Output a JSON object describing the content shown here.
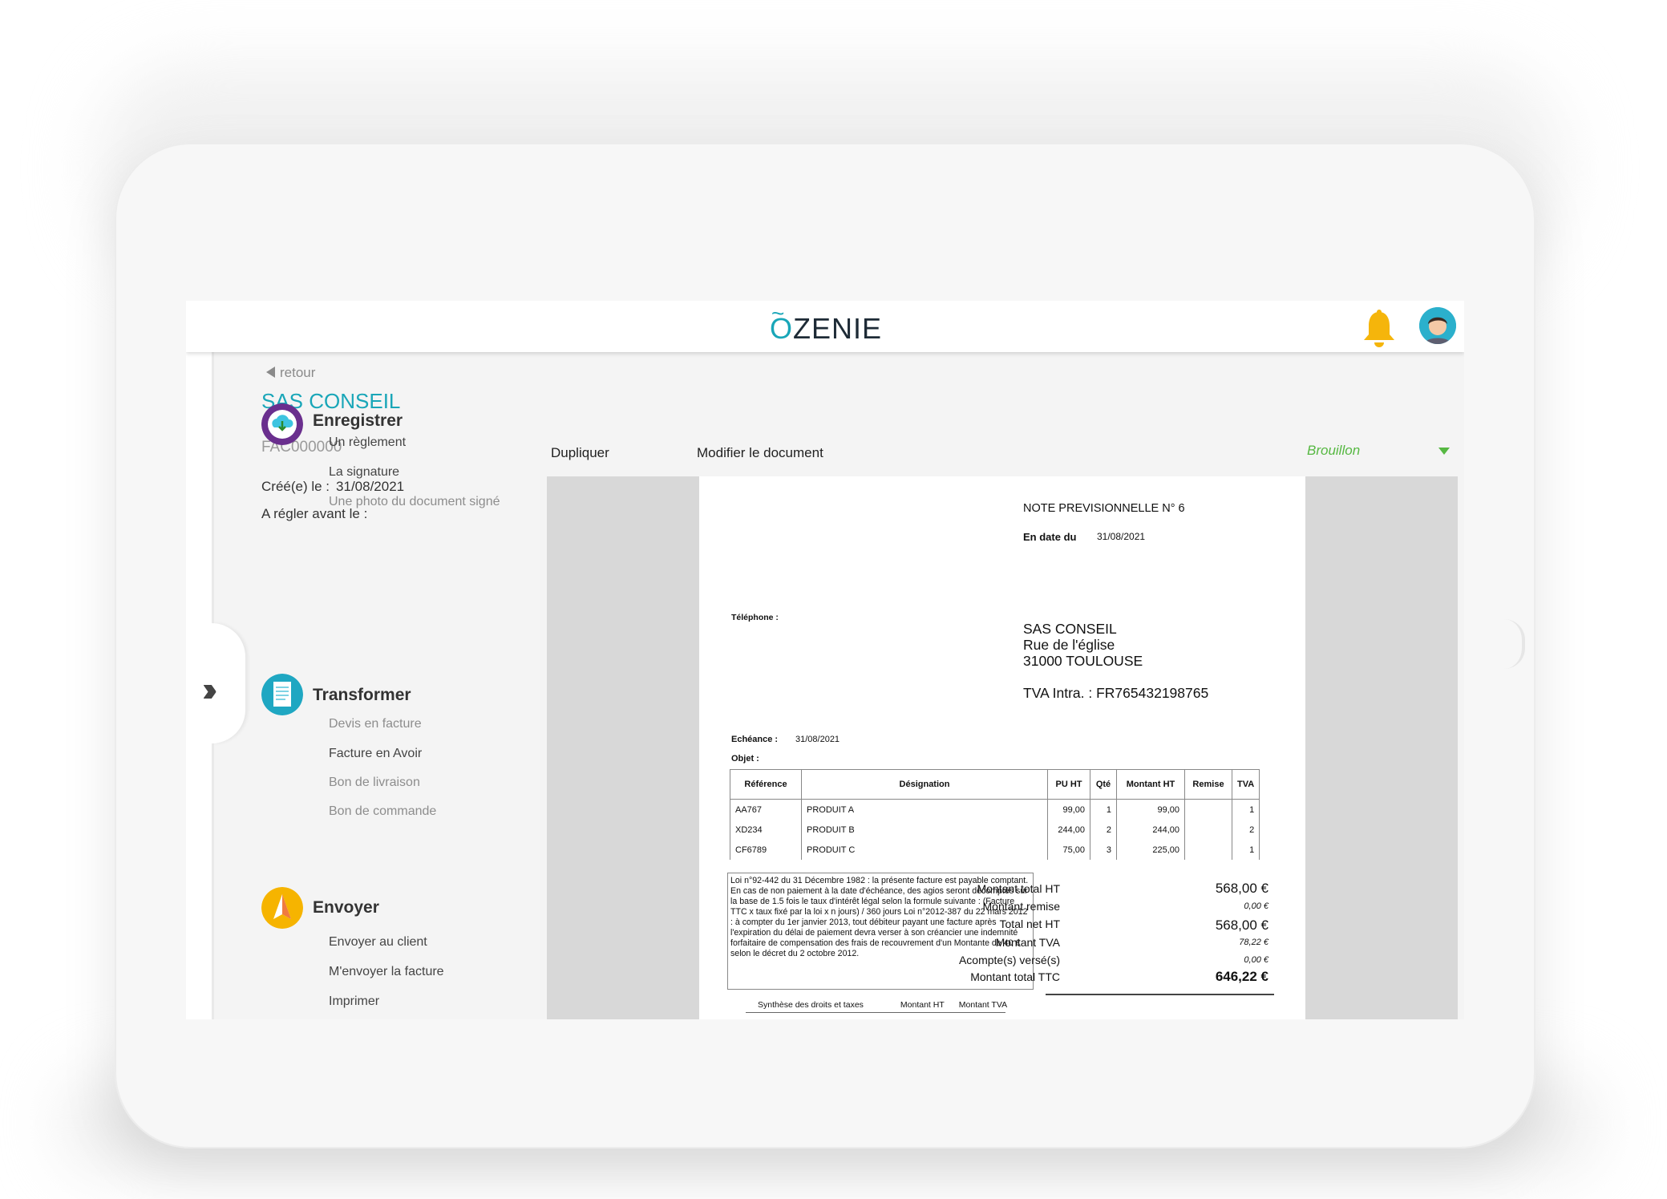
{
  "header": {
    "logo_text": "ZENIE",
    "logo_o": "O",
    "logo_tilde": "~",
    "bell_icon": "bell-icon",
    "avatar_icon": "user-avatar"
  },
  "sidebar": {
    "back_label": "retour",
    "company": "SAS CONSEIL",
    "doc_number": "FAC000000",
    "created_label": "Créé(e) le :",
    "created_date": "31/08/2021",
    "due_label": "A régler avant le :",
    "sections": [
      {
        "title": "Enregistrer",
        "icon": "cloud-download-icon",
        "items": [
          "Un règlement",
          "La signature",
          "Une photo du document signé"
        ]
      },
      {
        "title": "Transformer",
        "icon": "document-icon",
        "items": [
          "Devis en facture",
          "Facture en Avoir",
          "Bon de livraison",
          "Bon de commande"
        ]
      },
      {
        "title": "Envoyer",
        "icon": "paper-plane-icon",
        "items": [
          "Envoyer au client",
          "M'envoyer la facture",
          "Imprimer"
        ]
      }
    ]
  },
  "toolbar": {
    "duplicate": "Dupliquer",
    "edit": "Modifier le document",
    "status": "Brouillon"
  },
  "document": {
    "title": "NOTE PREVISIONNELLE  N° 6",
    "date_label": "En date du",
    "date_value": "31/08/2021",
    "phone_label": "Téléphone :",
    "client_name": "SAS CONSEIL",
    "client_street": "Rue de l'église",
    "client_city": "31000   TOULOUSE",
    "client_vat": "TVA Intra. : FR765432198765",
    "due_label": "Echéance :",
    "due_value": "31/08/2021",
    "object_label": "Objet :",
    "table_headers": [
      "Référence",
      "Désignation",
      "PU HT",
      "Qté",
      "Montant HT",
      "Remise",
      "TVA"
    ],
    "rows": [
      [
        "AA767",
        "PRODUIT A",
        "99,00",
        "1",
        "99,00",
        "",
        "1"
      ],
      [
        "XD234",
        "PRODUIT B",
        "244,00",
        "2",
        "244,00",
        "",
        "2"
      ],
      [
        "CF6789",
        "PRODUIT C",
        "75,00",
        "3",
        "225,00",
        "",
        "1"
      ]
    ],
    "legal_text": "Loi n°92-442 du 31 Décembre 1982 : la présente facture est payable comptant. En cas de non paiement à la date d'échéance, des agios seront décomptés sur la base de 1.5 fois le taux d'intérêt légal selon la formule suivante :   (Facture TTC x taux fixé par la loi x n jours) / 360 jours Loi n°2012-387 du 22 mars 2012 : à compter du 1er janvier 2013, tout débiteur payant une facture après l'expiration du délai de paiement devra verser à son créancier une indemnité forfaitaire de compensation des frais de recouvrement d'un Montante de 40 € selon le décret du 2 octobre 2012.",
    "totals": [
      {
        "label": "Montant total HT",
        "value": "568,00 €",
        "style": "big"
      },
      {
        "label": "Montant remise",
        "value": "0,00 €",
        "style": "small"
      },
      {
        "label": "Total net HT",
        "value": "568,00 €",
        "style": "big"
      },
      {
        "label": "Montant TVA",
        "value": "78,22 €",
        "style": "small"
      },
      {
        "label": "Acompte(s) versé(s)",
        "value": "0,00 €",
        "style": "small"
      },
      {
        "label": "Montant total TTC",
        "value": "646,22 €",
        "style": "bold"
      }
    ],
    "synth_title": "Synthèse des droits et taxes",
    "synth_col1": "Montant HT",
    "synth_col2": "Montant TVA"
  }
}
